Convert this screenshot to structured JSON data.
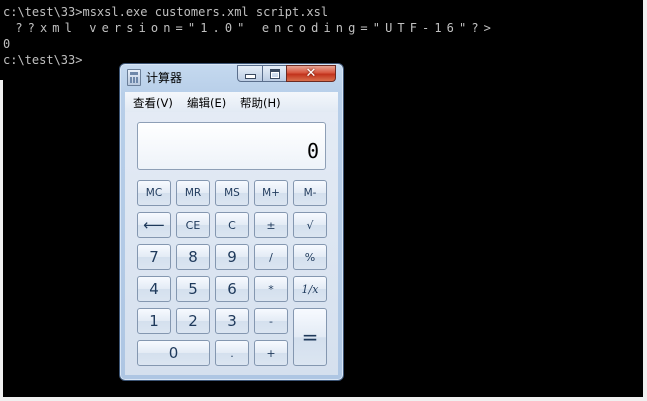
{
  "console": {
    "lines": [
      "c:\\test\\33>msxsl.exe customers.xml script.xsl",
      " ??xml version=\"1.0\" encoding=\"UTF-16\"?>",
      "0",
      "c:\\test\\33>"
    ]
  },
  "calculator": {
    "title": "计算器",
    "window_buttons": {
      "minimize": "",
      "maximize": "",
      "close": "✕"
    },
    "menu": [
      "查看(V)",
      "编辑(E)",
      "帮助(H)"
    ],
    "display_value": "0",
    "keys": {
      "row1": [
        "MC",
        "MR",
        "MS",
        "M+",
        "M-"
      ],
      "row2": [
        "⟵",
        "CE",
        "C",
        "±",
        "√"
      ],
      "row3": [
        "7",
        "8",
        "9",
        "/",
        "%"
      ],
      "row4": [
        "4",
        "5",
        "6",
        "*",
        "1/x"
      ],
      "row5": [
        "1",
        "2",
        "3",
        "-",
        "="
      ],
      "row6": [
        "0",
        ".",
        "+"
      ]
    }
  }
}
